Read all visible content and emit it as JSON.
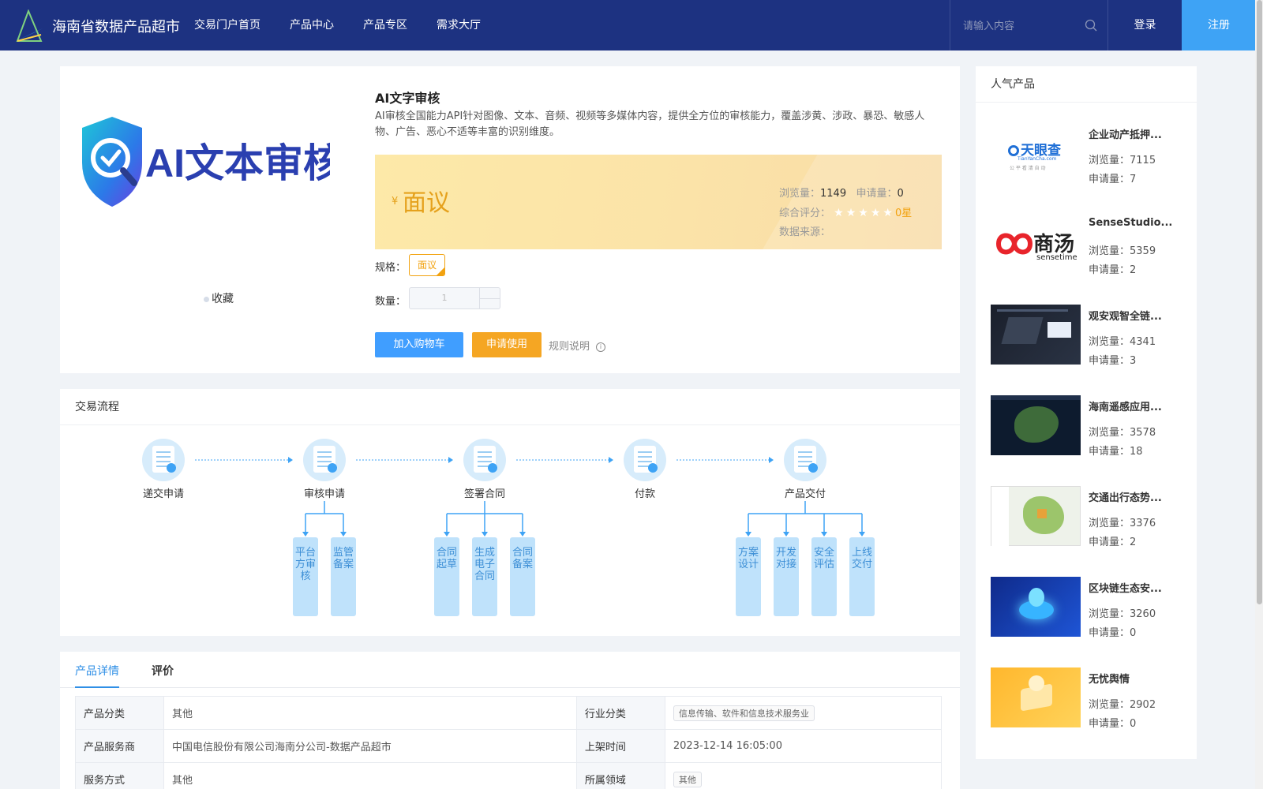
{
  "header": {
    "site_title": "海南省数据产品超市",
    "nav": [
      "交易门户首页",
      "产品中心",
      "产品专区",
      "需求大厅"
    ],
    "search_placeholder": "请输入内容",
    "login": "登录",
    "register": "注册"
  },
  "product": {
    "name": "AI文字审核",
    "image_text": "AI文本审核",
    "description": "AI审核全国能力API针对图像、文本、音频、视频等多媒体内容，提供全方位的审核能力，覆盖涉黄、涉政、暴恐、敏感人物、广告、恶心不适等丰富的识别维度。",
    "favorite": "收藏",
    "currency": "¥",
    "price": "面议",
    "views_label": "浏览量：",
    "views": "1149",
    "applications_label": "申请量：",
    "applications": "0",
    "rating_label": "综合评分：",
    "rating_value": 0,
    "rating_text": "0星",
    "source_label": "数据来源：",
    "spec_label": "规格：",
    "spec_value": "面议",
    "qty_label": "数量：",
    "qty_value": "1",
    "add_to_cart": "加入购物车",
    "apply": "申请使用",
    "rules": "规则说明",
    "colors": {
      "price": "#e5a11c",
      "primary": "#409eff",
      "apply": "#f5a623"
    }
  },
  "process": {
    "title": "交易流程",
    "steps": [
      {
        "label": "递交申请",
        "icon": "form-icon",
        "subs": []
      },
      {
        "label": "审核申请",
        "icon": "review-icon",
        "subs": [
          "平台方审核",
          "监管备案"
        ]
      },
      {
        "label": "签署合同",
        "icon": "contract-icon",
        "subs": [
          "合同起草",
          "生成电子合同",
          "合同备案"
        ]
      },
      {
        "label": "付款",
        "icon": "payment-icon",
        "subs": []
      },
      {
        "label": "产品交付",
        "icon": "delivery-icon",
        "subs": [
          "方案设计",
          "开发对接",
          "安全评估",
          "上线交付"
        ]
      }
    ]
  },
  "details": {
    "tabs": [
      "产品详情",
      "评价"
    ],
    "rows": [
      [
        "产品分类",
        "其他",
        "行业分类",
        "信息传输、软件和信息技术服务业"
      ],
      [
        "产品服务商",
        "中国电信股份有限公司海南分公司-数据产品超市",
        "上架时间",
        "2023-12-14 16:05:00"
      ],
      [
        "服务方式",
        "其他",
        "所属领域",
        "其他"
      ]
    ]
  },
  "sidebar": {
    "title": "人气产品",
    "views_label": "浏览量：",
    "applications_label": "申请量：",
    "items": [
      {
        "title": "企业动产抵押...",
        "views": "7115",
        "applications": "7",
        "thumb": "tianyancha-logo",
        "logo_text": "天眼查",
        "logo_sub": "TianYanCha.com",
        "logo_tag": "公 平 看 清 自 动"
      },
      {
        "title": "SenseStudio...",
        "views": "5359",
        "applications": "2",
        "thumb": "sensetime-logo",
        "logo_text": "商汤",
        "logo_sub": "sensetime"
      },
      {
        "title": "观安观智全链...",
        "views": "4341",
        "applications": "3",
        "thumb": "dashboard-screenshot"
      },
      {
        "title": "海南遥感应用...",
        "views": "3578",
        "applications": "18",
        "thumb": "satellite-map"
      },
      {
        "title": "交通出行态势...",
        "views": "3376",
        "applications": "2",
        "thumb": "traffic-map"
      },
      {
        "title": "区块链生态安...",
        "views": "3260",
        "applications": "0",
        "thumb": "blockchain-art"
      },
      {
        "title": "无忧舆情",
        "views": "2902",
        "applications": "0",
        "thumb": "sentiment-art"
      }
    ]
  }
}
